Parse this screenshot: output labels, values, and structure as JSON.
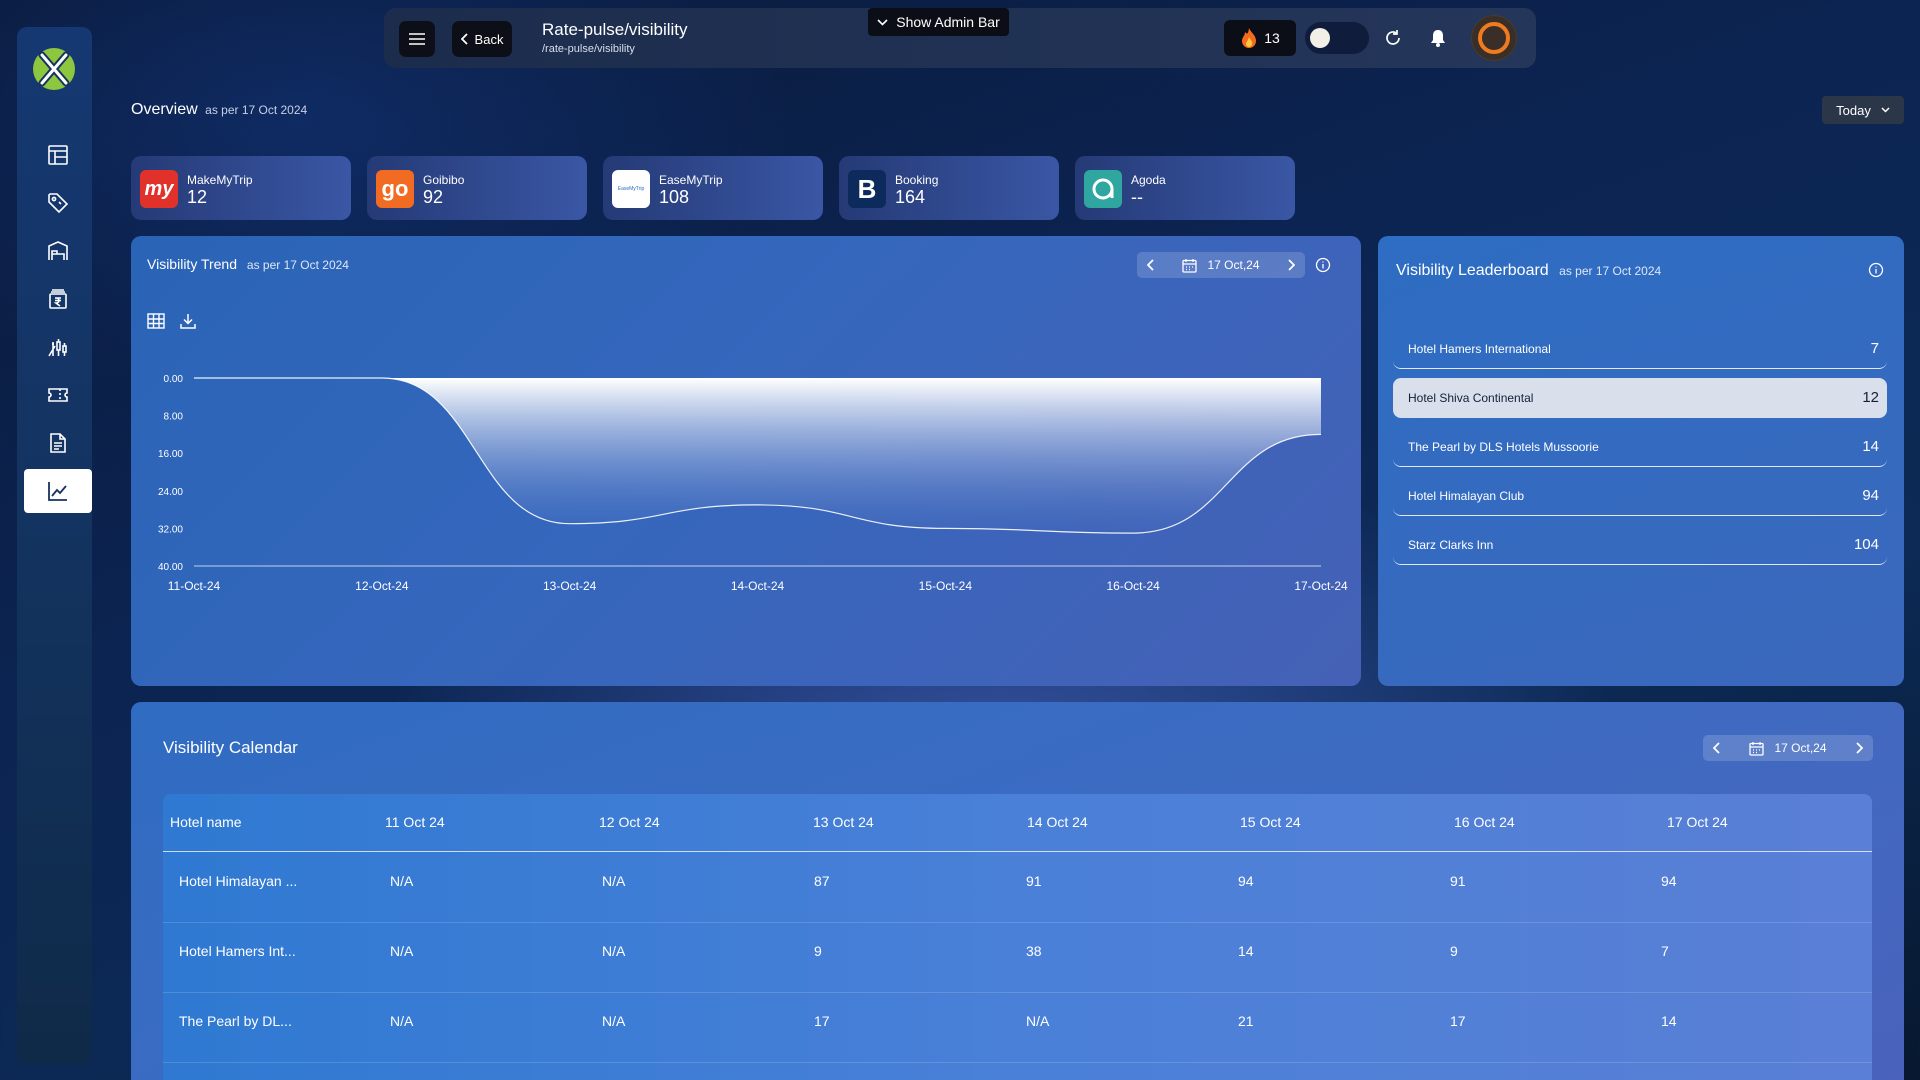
{
  "topbar": {
    "back_label": "Back",
    "title": "Rate-pulse/visibility",
    "path": "/rate-pulse/visibility",
    "admin_bar_label": "Show Admin Bar",
    "streak_count": "13"
  },
  "overview": {
    "title": "Overview",
    "as_of": "as per 17 Oct 2024",
    "period_label": "Today"
  },
  "ota_cards": [
    {
      "name": "MakeMyTrip",
      "value": "12"
    },
    {
      "name": "Goibibo",
      "value": "92"
    },
    {
      "name": "EaseMyTrip",
      "value": "108"
    },
    {
      "name": "Booking",
      "value": "164"
    },
    {
      "name": "Agoda",
      "value": "--"
    }
  ],
  "ota_logos": {
    "makemytrip": "my",
    "goibibo": "go",
    "easemytrip": "EaseMyTrip",
    "booking": "B"
  },
  "trend": {
    "title": "Visibility Trend",
    "as_of": "as per 17 Oct 2024",
    "date": "17 Oct,24"
  },
  "chart_data": {
    "type": "area",
    "title": "Visibility Trend",
    "x": [
      "11-Oct-24",
      "12-Oct-24",
      "13-Oct-24",
      "14-Oct-24",
      "15-Oct-24",
      "16-Oct-24",
      "17-Oct-24"
    ],
    "y_ticks": [
      "0.00",
      "8.00",
      "16.00",
      "24.00",
      "32.00",
      "40.00"
    ],
    "ylim": [
      0,
      40
    ],
    "y_reversed": true,
    "series": [
      {
        "values": [
          0,
          0,
          31,
          27,
          32,
          33,
          12
        ]
      }
    ],
    "colors": {
      "fill_top": "#ffffff",
      "fill_bottom": "#4a6fc0"
    }
  },
  "leaderboard": {
    "title": "Visibility Leaderboard",
    "as_of": "as per 17 Oct 2024",
    "rows": [
      {
        "name": "Hotel Hamers International",
        "value": "7"
      },
      {
        "name": "Hotel Shiva Continental",
        "value": "12"
      },
      {
        "name": "The Pearl by DLS Hotels Mussoorie",
        "value": "14"
      },
      {
        "name": "Hotel Himalayan Club",
        "value": "94"
      },
      {
        "name": "Starz Clarks Inn",
        "value": "104"
      }
    ]
  },
  "calendar": {
    "title": "Visibility Calendar",
    "date": "17 Oct,24",
    "columns": [
      "Hotel name",
      "11 Oct 24",
      "12 Oct 24",
      "13 Oct 24",
      "14 Oct 24",
      "15 Oct 24",
      "16 Oct 24",
      "17 Oct 24"
    ],
    "rows": [
      [
        "Hotel Himalayan ...",
        "N/A",
        "N/A",
        "87",
        "91",
        "94",
        "91",
        "94"
      ],
      [
        "Hotel Hamers Int...",
        "N/A",
        "N/A",
        "9",
        "38",
        "14",
        "9",
        "7"
      ],
      [
        "The Pearl by DL...",
        "N/A",
        "N/A",
        "17",
        "N/A",
        "21",
        "17",
        "14"
      ]
    ]
  }
}
